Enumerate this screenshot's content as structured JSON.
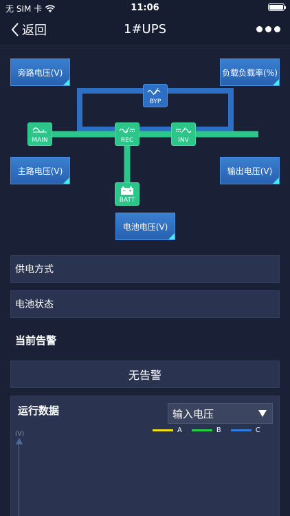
{
  "status_bar": {
    "carrier": "无 SIM 卡",
    "time": "11:06"
  },
  "nav": {
    "back_label": "返回",
    "title": "1#UPS"
  },
  "diagram": {
    "boxes": {
      "bypass_voltage": "旁路电压(V)",
      "load_rate": "负载负载率(%)",
      "main_voltage": "主路电压(V)",
      "output_voltage": "输出电压(V)",
      "battery_voltage": "电池电压(V)"
    },
    "nodes": {
      "main": "MAIN",
      "rec": "REC",
      "inv": "INV",
      "byp": "BYP",
      "batt": "BATT"
    },
    "colors": {
      "green_line": "#2cc58a",
      "blue_line": "#2d6fc4",
      "box_accent": "#3ff0f0"
    }
  },
  "info": {
    "power_supply_mode": "供电方式",
    "battery_status": "电池状态"
  },
  "alarm": {
    "section_title": "当前告警",
    "message": "无告警"
  },
  "run_data": {
    "title": "运行数据",
    "selected": "输入电压",
    "unit": "(V)",
    "legend": [
      {
        "name": "A",
        "color": "#f2e318"
      },
      {
        "name": "B",
        "color": "#27d147"
      },
      {
        "name": "C",
        "color": "#2f7ee0"
      }
    ]
  }
}
